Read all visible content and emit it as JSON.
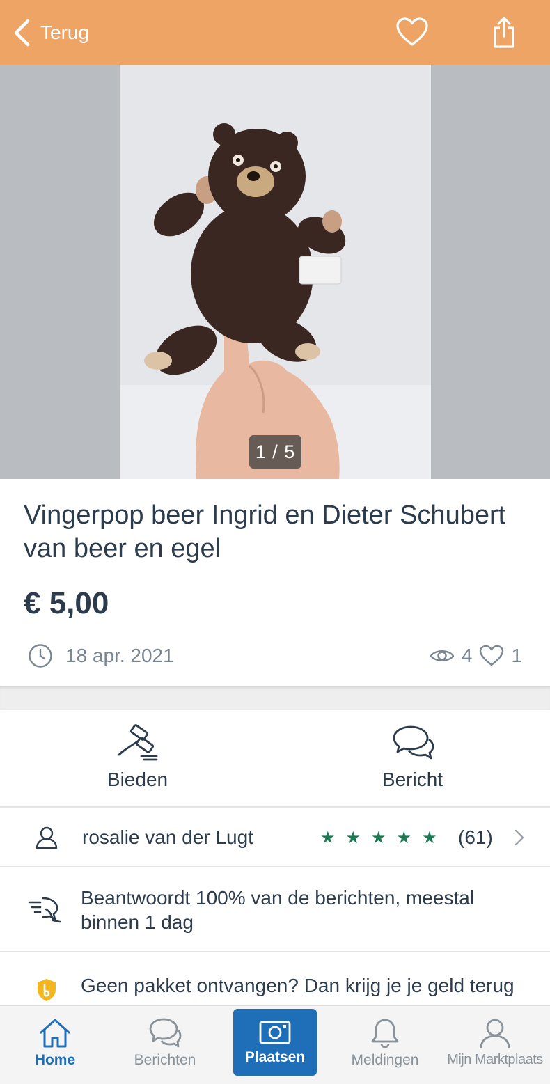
{
  "header": {
    "back_label": "Terug",
    "icons": [
      "chevron-left-icon",
      "heart-icon",
      "share-icon"
    ],
    "background": "#eda465"
  },
  "photo": {
    "counter": "1 / 5"
  },
  "listing": {
    "title": "Vingerpop beer Ingrid en Dieter Schubert van beer en egel",
    "price": "€ 5,00",
    "date": "18 apr. 2021",
    "views": "4",
    "favorites": "1"
  },
  "actions": {
    "bid_label": "Bieden",
    "message_label": "Bericht"
  },
  "seller": {
    "name": "rosalie van der Lugt",
    "rating_stars": 5,
    "review_count": "(61)",
    "star_color": "#1d7a54"
  },
  "response": {
    "text": "Beantwoordt 100% van de berichten, meestal binnen 1 dag"
  },
  "protection": {
    "text": "Geen pakket ontvangen? Dan krijg je je geld terug"
  },
  "bottom_nav": {
    "home": "Home",
    "messages": "Berichten",
    "post": "Plaatsen",
    "notifications": "Meldingen",
    "my_account": "Mijn Marktplaats",
    "accent": "#1f6fb8"
  }
}
